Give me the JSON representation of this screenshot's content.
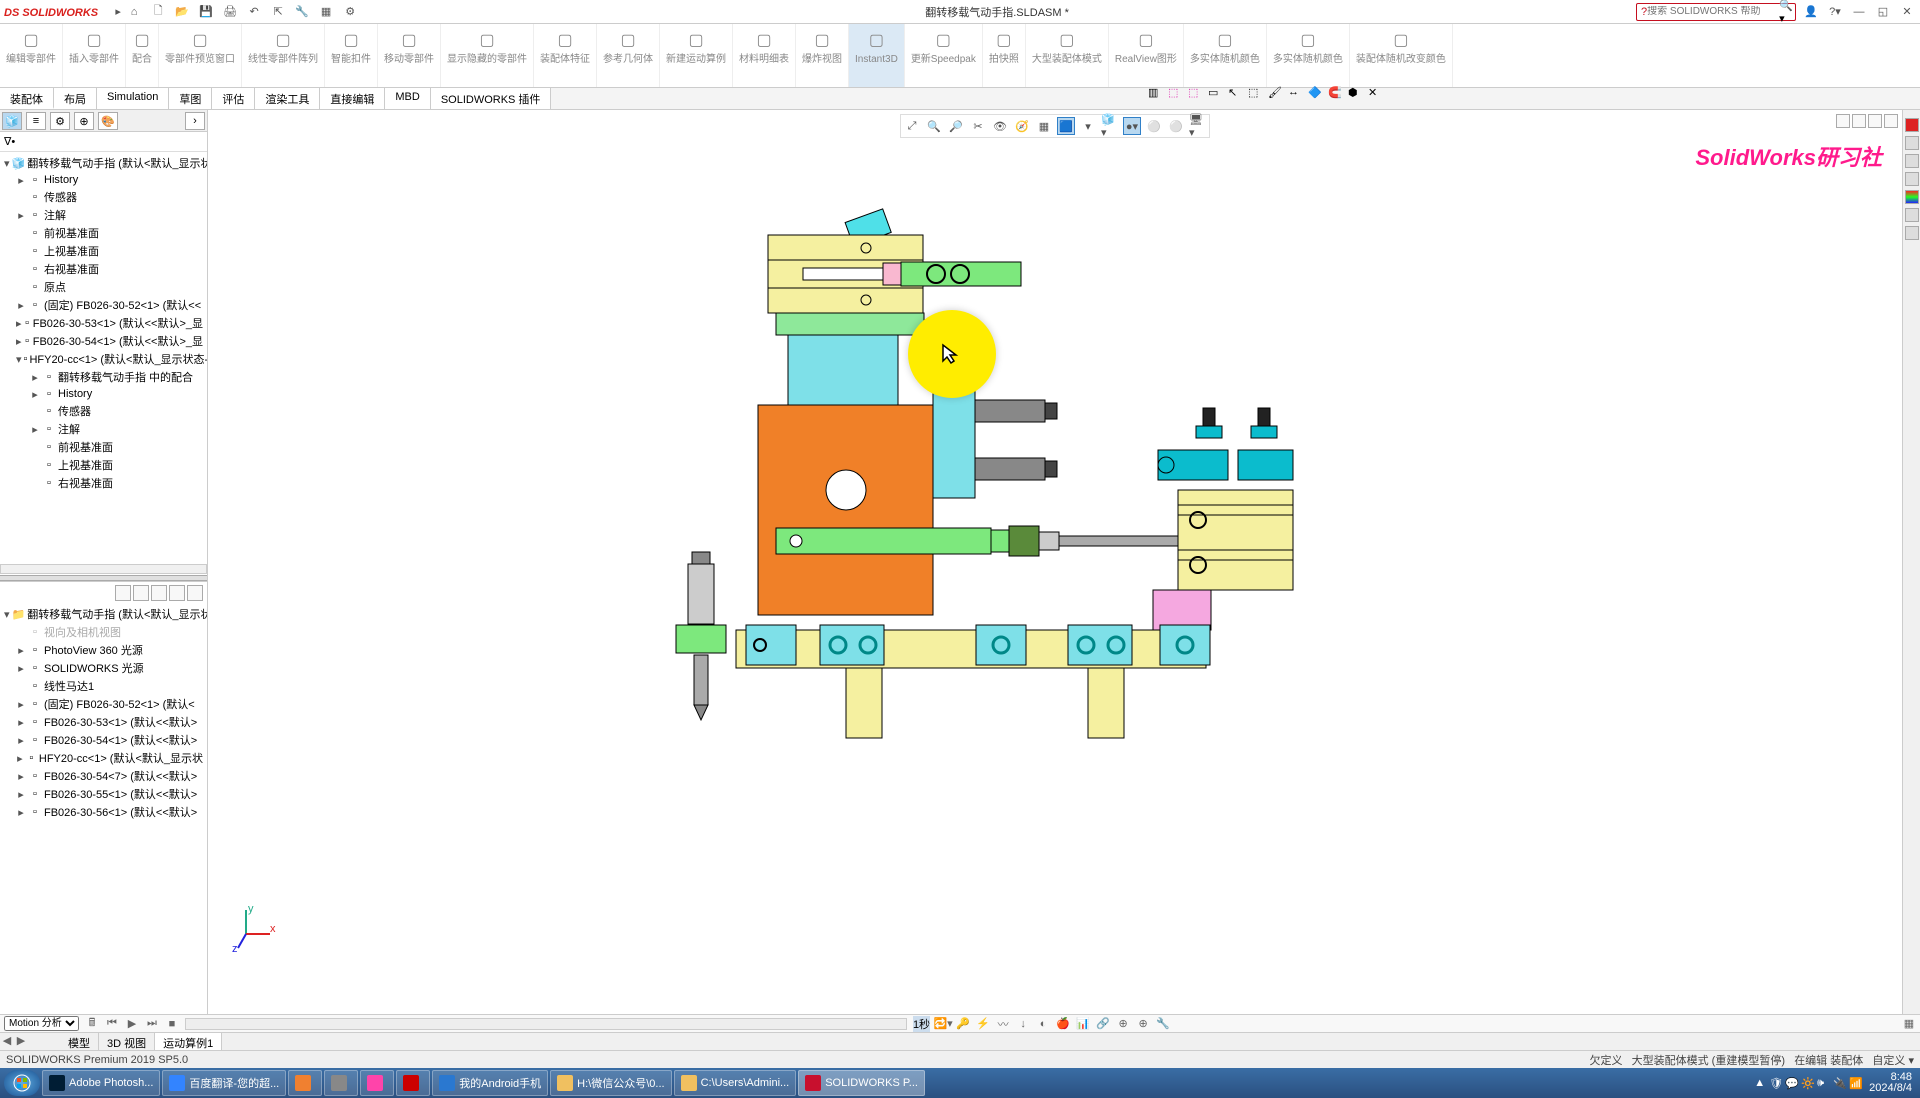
{
  "app": {
    "logo": "SOLIDWORKS",
    "title": "翻转移载气动手指.SLDASM *",
    "search_placeholder": "搜索 SOLIDWORKS 帮助"
  },
  "ribbon": [
    {
      "label": "编辑零部件",
      "icon": "edit"
    },
    {
      "label": "插入零部件",
      "icon": "insert"
    },
    {
      "label": "配合",
      "icon": "mate"
    },
    {
      "label": "零部件预览窗口",
      "icon": "preview"
    },
    {
      "label": "线性零部件阵列",
      "icon": "linpat"
    },
    {
      "label": "智能扣件",
      "icon": "smart"
    },
    {
      "label": "移动零部件",
      "icon": "move"
    },
    {
      "label": "显示隐藏的零部件",
      "icon": "showhide"
    },
    {
      "label": "装配体特征",
      "icon": "asmfeat"
    },
    {
      "label": "参考几何体",
      "icon": "refgeom"
    },
    {
      "label": "新建运动算例",
      "icon": "motion"
    },
    {
      "label": "材料明细表",
      "icon": "bom"
    },
    {
      "label": "爆炸视图",
      "icon": "explode"
    },
    {
      "label": "Instant3D",
      "icon": "i3d"
    },
    {
      "label": "更新Speedpak",
      "icon": "speedpak"
    },
    {
      "label": "拍快照",
      "icon": "snap"
    },
    {
      "label": "大型装配体模式",
      "icon": "large"
    },
    {
      "label": "RealView图形",
      "icon": "realview"
    },
    {
      "label": "多实体随机颜色",
      "icon": "multi1"
    },
    {
      "label": "多实体随机颜色",
      "icon": "multi2"
    },
    {
      "label": "装配体随机改变颜色",
      "icon": "randcol"
    }
  ],
  "tabs": [
    "装配体",
    "布局",
    "Simulation",
    "草图",
    "评估",
    "渲染工具",
    "直接编辑",
    "MBD",
    "SOLIDWORKS 插件"
  ],
  "tree_root": "翻转移载气动手指 (默认<默认_显示状态-",
  "tree": [
    {
      "label": "History",
      "icon": "hist",
      "indent": 1,
      "exp": "▸"
    },
    {
      "label": "传感器",
      "icon": "sensor",
      "indent": 1
    },
    {
      "label": "注解",
      "icon": "annot",
      "indent": 1,
      "exp": "▸"
    },
    {
      "label": "前视基准面",
      "icon": "plane",
      "indent": 1
    },
    {
      "label": "上视基准面",
      "icon": "plane",
      "indent": 1
    },
    {
      "label": "右视基准面",
      "icon": "plane",
      "indent": 1
    },
    {
      "label": "原点",
      "icon": "origin",
      "indent": 1
    },
    {
      "label": "(固定) FB026-30-52<1> (默认<<",
      "icon": "part",
      "indent": 1,
      "exp": "▸"
    },
    {
      "label": "FB026-30-53<1> (默认<<默认>_显",
      "icon": "part",
      "indent": 1,
      "exp": "▸"
    },
    {
      "label": "FB026-30-54<1> (默认<<默认>_显",
      "icon": "part",
      "indent": 1,
      "exp": "▸"
    },
    {
      "label": "HFY20-cc<1> (默认<默认_显示状态-",
      "icon": "asm",
      "indent": 1,
      "exp": "▾"
    },
    {
      "label": "翻转移载气动手指 中的配合",
      "icon": "mates",
      "indent": 2,
      "exp": "▸"
    },
    {
      "label": "History",
      "icon": "hist",
      "indent": 2,
      "exp": "▸"
    },
    {
      "label": "传感器",
      "icon": "sensor",
      "indent": 2
    },
    {
      "label": "注解",
      "icon": "annot",
      "indent": 2,
      "exp": "▸"
    },
    {
      "label": "前视基准面",
      "icon": "plane",
      "indent": 2
    },
    {
      "label": "上视基准面",
      "icon": "plane",
      "indent": 2
    },
    {
      "label": "右视基准面",
      "icon": "plane",
      "indent": 2
    }
  ],
  "lowerRoot": "翻转移载气动手指 (默认<默认_显示状",
  "lower": [
    {
      "label": "视向及相机视图",
      "icon": "cam",
      "indent": 1,
      "dim": true
    },
    {
      "label": "PhotoView 360 光源",
      "icon": "pv",
      "indent": 1,
      "exp": "▸"
    },
    {
      "label": "SOLIDWORKS 光源",
      "icon": "light",
      "indent": 1,
      "exp": "▸"
    },
    {
      "label": "线性马达1",
      "icon": "motor",
      "indent": 1
    },
    {
      "label": "(固定) FB026-30-52<1> (默认<",
      "icon": "part",
      "indent": 1,
      "exp": "▸"
    },
    {
      "label": "FB026-30-53<1> (默认<<默认>",
      "icon": "part",
      "indent": 1,
      "exp": "▸"
    },
    {
      "label": "FB026-30-54<1> (默认<<默认>",
      "icon": "part",
      "indent": 1,
      "exp": "▸"
    },
    {
      "label": "HFY20-cc<1> (默认<默认_显示状",
      "icon": "asm",
      "indent": 1,
      "exp": "▸"
    },
    {
      "label": "FB026-30-54<7> (默认<<默认>",
      "icon": "part",
      "indent": 1,
      "exp": "▸"
    },
    {
      "label": "FB026-30-55<1> (默认<<默认>",
      "icon": "part",
      "indent": 1,
      "exp": "▸"
    },
    {
      "label": "FB026-30-56<1> (默认<<默认>",
      "icon": "part",
      "indent": 1,
      "exp": "▸"
    }
  ],
  "motion": {
    "mode": "Motion 分析",
    "time": "1秒"
  },
  "bottomTabs": [
    "模型",
    "3D 视图",
    "运动算例1"
  ],
  "status": {
    "left": "SOLIDWORKS Premium 2019 SP5.0",
    "right1": "欠定义",
    "right2": "大型装配体模式 (重建模型暂停)",
    "right3": "在编辑 装配体",
    "right4": "自定义"
  },
  "taskbar": [
    {
      "label": "Adobe Photosh...",
      "color": "#001d34"
    },
    {
      "label": "百度翻译-您的超...",
      "color": "#3384ff"
    },
    {
      "label": "",
      "color": "#f08030"
    },
    {
      "label": "",
      "color": "#888"
    },
    {
      "label": "",
      "color": "#f4a"
    },
    {
      "label": "",
      "color": "#c00"
    },
    {
      "label": "我的Android手机",
      "color": "#2a78d0"
    },
    {
      "label": "H:\\微信公众号\\0...",
      "color": "#f0c060"
    },
    {
      "label": "C:\\Users\\Admini...",
      "color": "#f0c060"
    },
    {
      "label": "SOLIDWORKS P...",
      "color": "#c8102e",
      "active": true
    }
  ],
  "clock": {
    "time": "8:48",
    "date": "2024/8/4"
  },
  "watermark": "SolidWorks研习社",
  "triad": {
    "x": "x",
    "y": "y",
    "z": "z"
  }
}
